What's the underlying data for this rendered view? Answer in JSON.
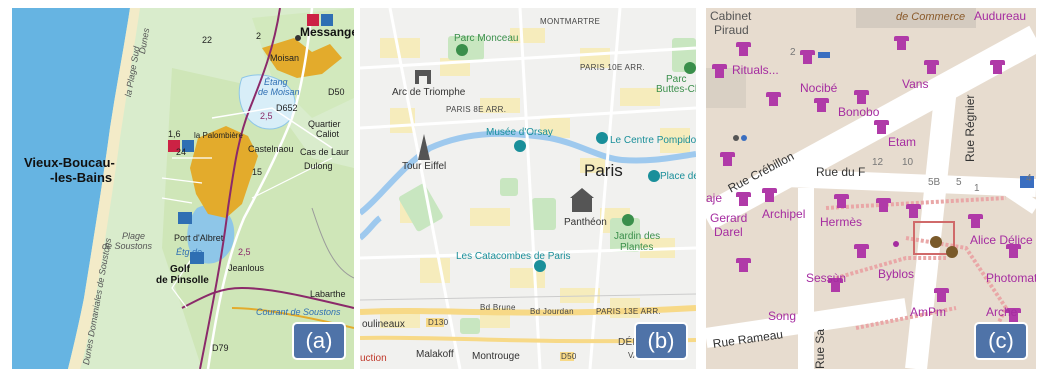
{
  "colors": {
    "badge": "#4f73a8",
    "map_a_sea": "#66b4e2",
    "map_a_land": "#d9eccc",
    "map_a_town": "#e3ab2c",
    "map_b_base": "#f1f1ef",
    "map_b_river": "#9ec9ee",
    "map_c_base": "#e7dccf",
    "map_c_shop": "#a52ca0"
  },
  "panel_a": {
    "badge": "(a)",
    "icon": "tourist-info-icon",
    "labels": {
      "messanges": "Messanges",
      "vieux_1": "Vieux-Boucau-",
      "vieux_2": "-les-Bains",
      "moisan": "Moisan",
      "etang_1": "Étang",
      "etang_2": "de Moisan",
      "quartier": "Quartier",
      "caliot": "Caliot",
      "castelnaou": "Castelnaou",
      "dulong": "Dulong",
      "la_palombiere": "la Palombière",
      "cas_de_laur": "Cas de Laur",
      "plage_1": "Plage",
      "plage_2": "de Soustons",
      "port_albret": "Port d'Albret",
      "etg_de": "Étg de",
      "golf_1": "Golf",
      "golf_2": "de Pinsolle",
      "jeanlous": "Jeanlous",
      "labarthe": "Labarthe",
      "courant": "Courant de Soustons",
      "la_plage_sud": "la Plage Sud",
      "dunes": "Dunes",
      "dunes_dom": "Dunes Domaniales de Soustons",
      "d652": "D652",
      "d50": "D50",
      "d79": "D79",
      "n2": "2",
      "n16": "1,6",
      "n22": "22",
      "n24": "24",
      "n25": "2,5",
      "n25b": "2,5",
      "n15": "15"
    }
  },
  "panel_b": {
    "badge": "(b)",
    "labels": {
      "parc_monceau": "Parc Monceau",
      "montmartre": "MONTMARTRE",
      "paris10": "PARIS 10E ARR.",
      "parc_1": "Parc",
      "parc_2": "Buttes-Ch",
      "arc": "Arc de Triomphe",
      "paris8": "PARIS 8E ARR.",
      "musee": "Musée d'Orsay",
      "pompidou": "Le Centre Pompidou",
      "tour": "Tour Eiffel",
      "paris": "Paris",
      "place": "Place de l",
      "pantheon": "Panthéon",
      "jardin_1": "Jardin des",
      "jardin_2": "Plantes",
      "catacombes": "Les Catacombes de Paris",
      "paris13": "PARIS 13E ARR.",
      "depart": "DÉPART",
      "moulineaux": "oulineaux",
      "malakoff": "Malakoff",
      "montrouge": "Montrouge",
      "uction": "uction",
      "d130": "D130",
      "d50": "D50",
      "bd_brune": "Bd Brune",
      "bd_jourdan": "Bd Jourdan",
      "val": "VAL-"
    }
  },
  "panel_c": {
    "badge": "(c)",
    "labels": {
      "cabinet": "Cabinet",
      "piraud": "Piraud",
      "commerce": "de Commerce",
      "audureau": "Audureau",
      "rituals": "Rituals...",
      "vans": "Vans",
      "nocibe": "Nocibé",
      "bonobo": "Bonobo",
      "rue_crebillon": "Rue Crébillon",
      "etam": "Etam",
      "rue_regnier": "Rue Régnier",
      "n12": "12",
      "n10": "10",
      "n2": "2",
      "n4": "4",
      "n5b": "5B",
      "n5": "5",
      "n1": "1",
      "rue_du_f": "Rue du F",
      "aje": "aje",
      "archipel": "Archipel",
      "gerard": "Gerard",
      "darel": "Darel",
      "hermes": "Hermès",
      "alice": "Alice Délice",
      "byblos": "Byblos",
      "photomat": "Photomat",
      "sessun": "Sessùn",
      "song": "Song",
      "ampm": "AmPm",
      "arche": "Arche",
      "rue_rameau": "Rue Rameau",
      "rue_sa": "Rue Sa"
    }
  }
}
